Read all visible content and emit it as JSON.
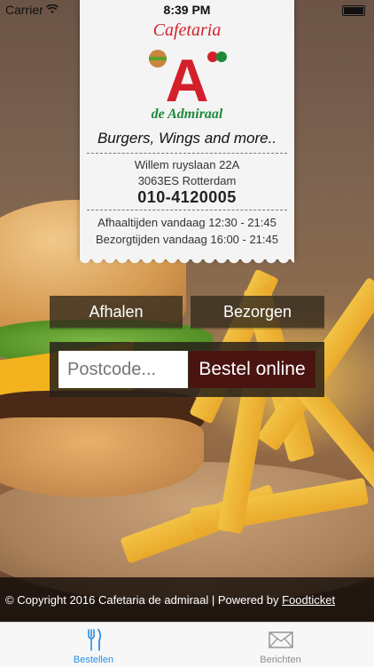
{
  "status_bar": {
    "carrier": "Carrier",
    "time": "8:39 PM"
  },
  "card": {
    "logo": {
      "line1": "Cafetaria",
      "letter": "A",
      "line2": "de Admiraal"
    },
    "tagline": "Burgers, Wings and more..",
    "address_line1": "Willem ruyslaan 22A",
    "address_line2": "3063ES Rotterdam",
    "phone": "010-4120005",
    "pickup_hours": "Afhaaltijden vandaag 12:30 - 21:45",
    "delivery_hours": "Bezorgtijden vandaag 16:00 - 21:45"
  },
  "order": {
    "pickup_label": "Afhalen",
    "delivery_label": "Bezorgen",
    "postcode_placeholder": "Postcode...",
    "order_button": "Bestel online"
  },
  "footer": {
    "copyright": "© Copyright 2016 Cafetaria de admiraal | Powered by ",
    "powered_link": "Foodticket"
  },
  "tabbar": {
    "tabs": [
      {
        "label": "Bestellen",
        "icon": "fork-knife-icon",
        "active": true
      },
      {
        "label": "Berichten",
        "icon": "envelope-icon",
        "active": false
      }
    ]
  },
  "colors": {
    "active_tab": "#2a8ee6",
    "inactive_tab": "#8e8e8e",
    "order_button": "#4a1411",
    "logo_red": "#d3202a",
    "logo_green": "#1d8a3a"
  }
}
